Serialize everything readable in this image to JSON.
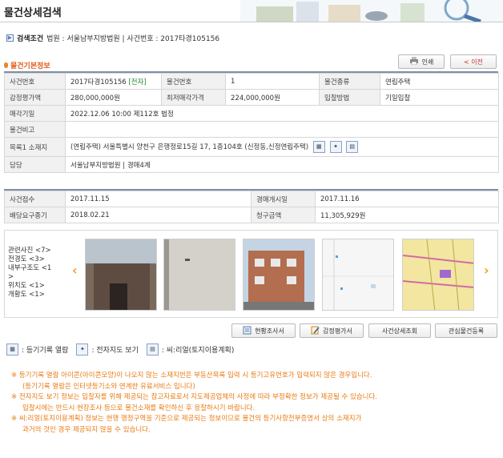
{
  "page": {
    "title": "물건상세검색"
  },
  "search_condition": {
    "label": "검색조건",
    "text": "법원 : 서울남부지방법원 | 사건번호 : 2017타경105156"
  },
  "section": {
    "title": "물건기본정보"
  },
  "buttons": {
    "print": "인쇄",
    "back": "< 이전"
  },
  "basic_info": {
    "case_no_label": "사건번호",
    "case_no": "2017타경105156",
    "case_tag": "[전자]",
    "item_no_label": "물건번호",
    "item_no": "1",
    "item_type_label": "물건종류",
    "item_type": "연립주택",
    "appraisal_label": "감정평가액",
    "appraisal": "280,000,000원",
    "min_price_label": "최저매각가격",
    "min_price": "224,000,000원",
    "bid_method_label": "입찰방법",
    "bid_method": "기일입찰",
    "sale_date_label": "매각기일",
    "sale_date": "2022.12.06 10:00 제112호 법정",
    "remarks_label": "물건비고",
    "remarks": "",
    "location_label": "목록1 소재지",
    "location": "(연립주택) 서울특별시 양천구 은행정로15길 17, 1층104호 (신정동,신정연립주택)",
    "manager_label": "담당",
    "manager": "서울남부지방법원 | 경매4계"
  },
  "case_info": {
    "received_label": "사건접수",
    "received": "2017.11.15",
    "start_label": "경매개시일",
    "start": "2017.11.16",
    "deadline_label": "배당요구종기",
    "deadline": "2018.02.21",
    "claim_label": "청구금액",
    "claim": "11,305,929원"
  },
  "photos": {
    "labels": [
      "관련사진 <7>",
      "전경도 <3>",
      "내부구조도 <1",
      ">",
      "위치도 <1>",
      "개황도 <1>"
    ]
  },
  "actions": {
    "survey": "현황조사서",
    "appraisal_doc": "감정평가서",
    "case_detail": "사건상세조회",
    "interest": "관심물건등록"
  },
  "legend": {
    "registry": ": 등기기록 열람",
    "map": ": 전자지도 보기",
    "land": ": 씨:리얼(토지이용계획)"
  },
  "notes": [
    "※ 등기기록 열람 아이콘(아이콘모양)이 나오지 않는 소재지번은 부동산목록 입력 시 등기고유번호가 입력되지 않은 경우입니다.",
    "(등기기록 열람은 인터넷등기소와 연계한 유료서비스 입니다)",
    "※ 전자지도 보기 정보는 입찰자를 위해 제공되는 참고자료로서 지도제공업체의 사정에 따라 부정확한 정보가 제공될 수 있습니다.",
    "입찰시에는 반드시 현장조사 등으로 물건소재를 확인하신 후 응찰하시기 바랍니다.",
    "※ 씨:리얼(토지이용계획) 정보는 현행 행정구역을 기준으로 제공되는 정보이므로 물건의 등기사항전부증명서 상의 소재지가",
    "과거의 것인 경우 제공되지 않을 수 있습니다."
  ]
}
